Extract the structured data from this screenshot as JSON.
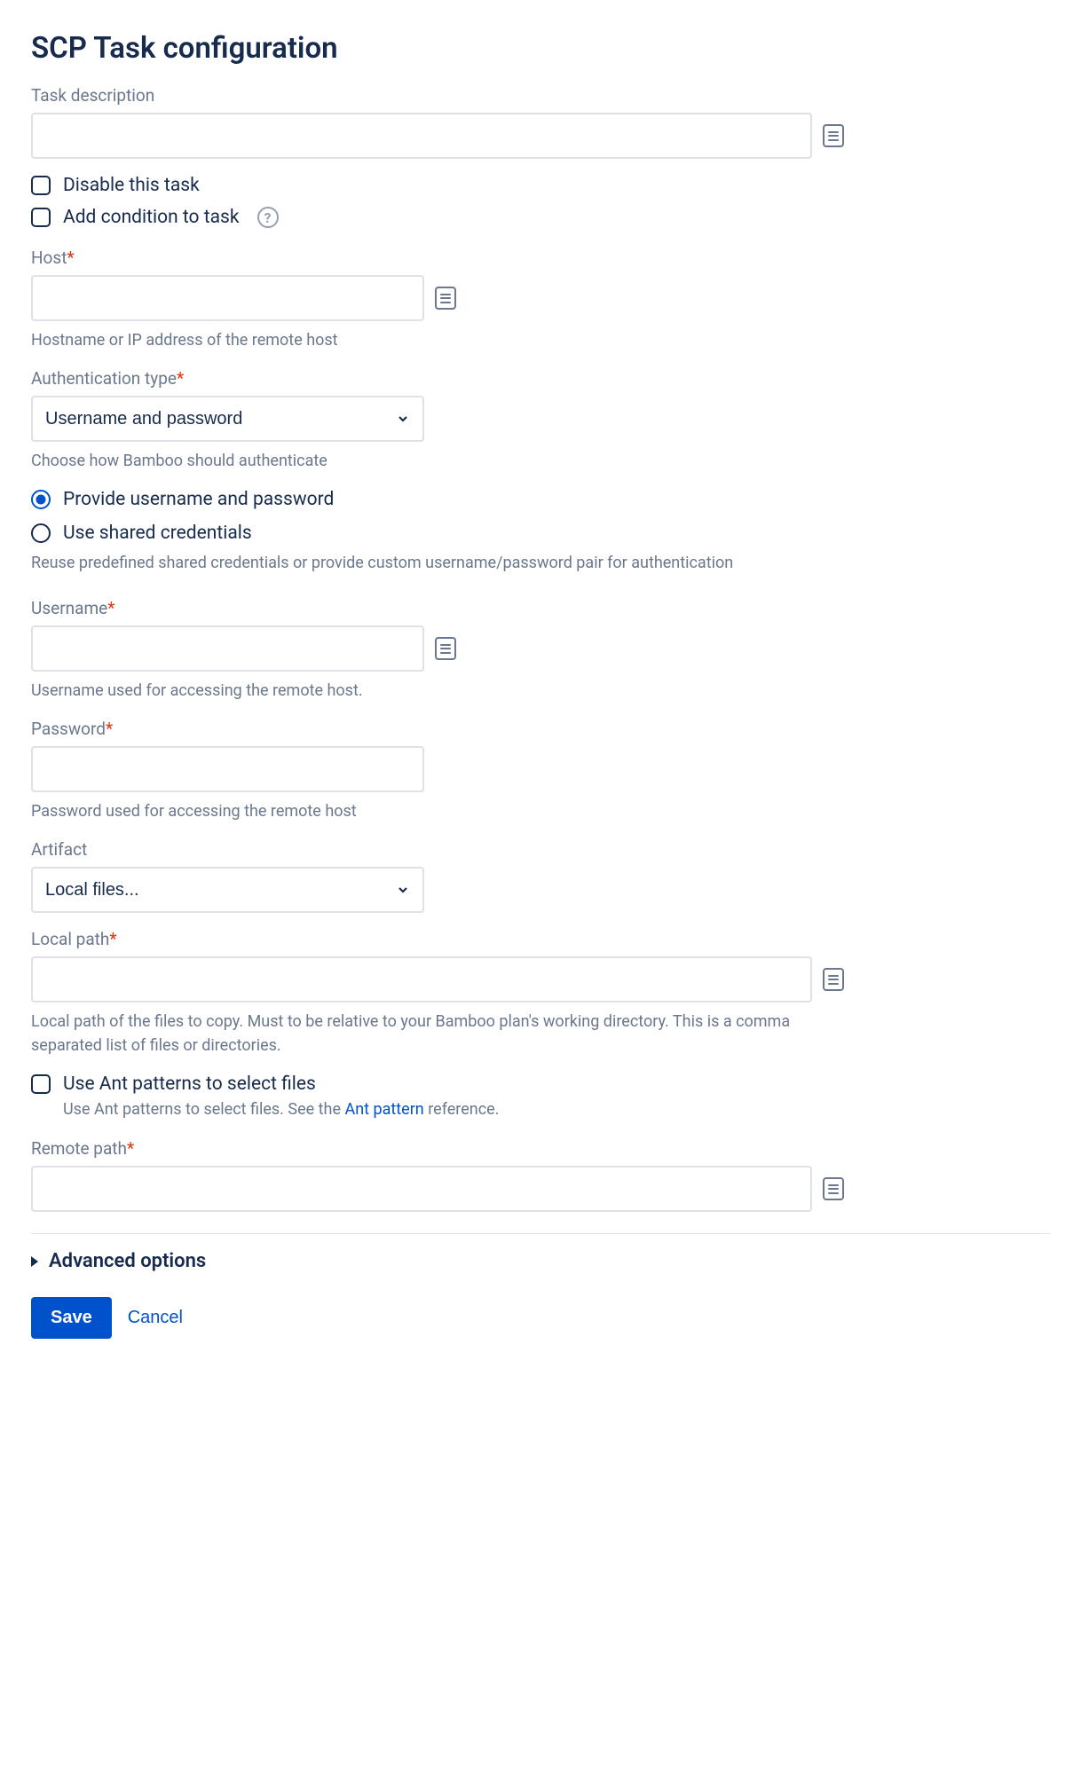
{
  "title": "SCP Task configuration",
  "task_description": {
    "label": "Task description",
    "value": ""
  },
  "disable_task": {
    "label": "Disable this task",
    "checked": false
  },
  "add_condition": {
    "label": "Add condition to task",
    "checked": false
  },
  "host": {
    "label": "Host",
    "value": "",
    "helper": "Hostname or IP address of the remote host"
  },
  "auth_type": {
    "label": "Authentication type",
    "selected": "Username and password",
    "helper": "Choose how Bamboo should authenticate"
  },
  "auth_mode": {
    "option1": "Provide username and password",
    "option2": "Use shared credentials",
    "selected": "option1",
    "helper": "Reuse predefined shared credentials or provide custom username/password pair for authentication"
  },
  "username": {
    "label": "Username",
    "value": "",
    "helper": "Username used for accessing the remote host."
  },
  "password": {
    "label": "Password",
    "value": "",
    "helper": "Password used for accessing the remote host"
  },
  "artifact": {
    "label": "Artifact",
    "selected": "Local files..."
  },
  "local_path": {
    "label": "Local path",
    "value": "",
    "helper": "Local path of the files to copy. Must to be relative to your Bamboo plan's working directory. This is a comma separated list of files or directories."
  },
  "ant_patterns": {
    "label": "Use Ant patterns to select files",
    "checked": false,
    "helper_pre": "Use Ant patterns to select files. See the ",
    "helper_link": "Ant pattern",
    "helper_post": " reference."
  },
  "remote_path": {
    "label": "Remote path",
    "value": ""
  },
  "advanced_options_label": "Advanced options",
  "buttons": {
    "save": "Save",
    "cancel": "Cancel"
  }
}
